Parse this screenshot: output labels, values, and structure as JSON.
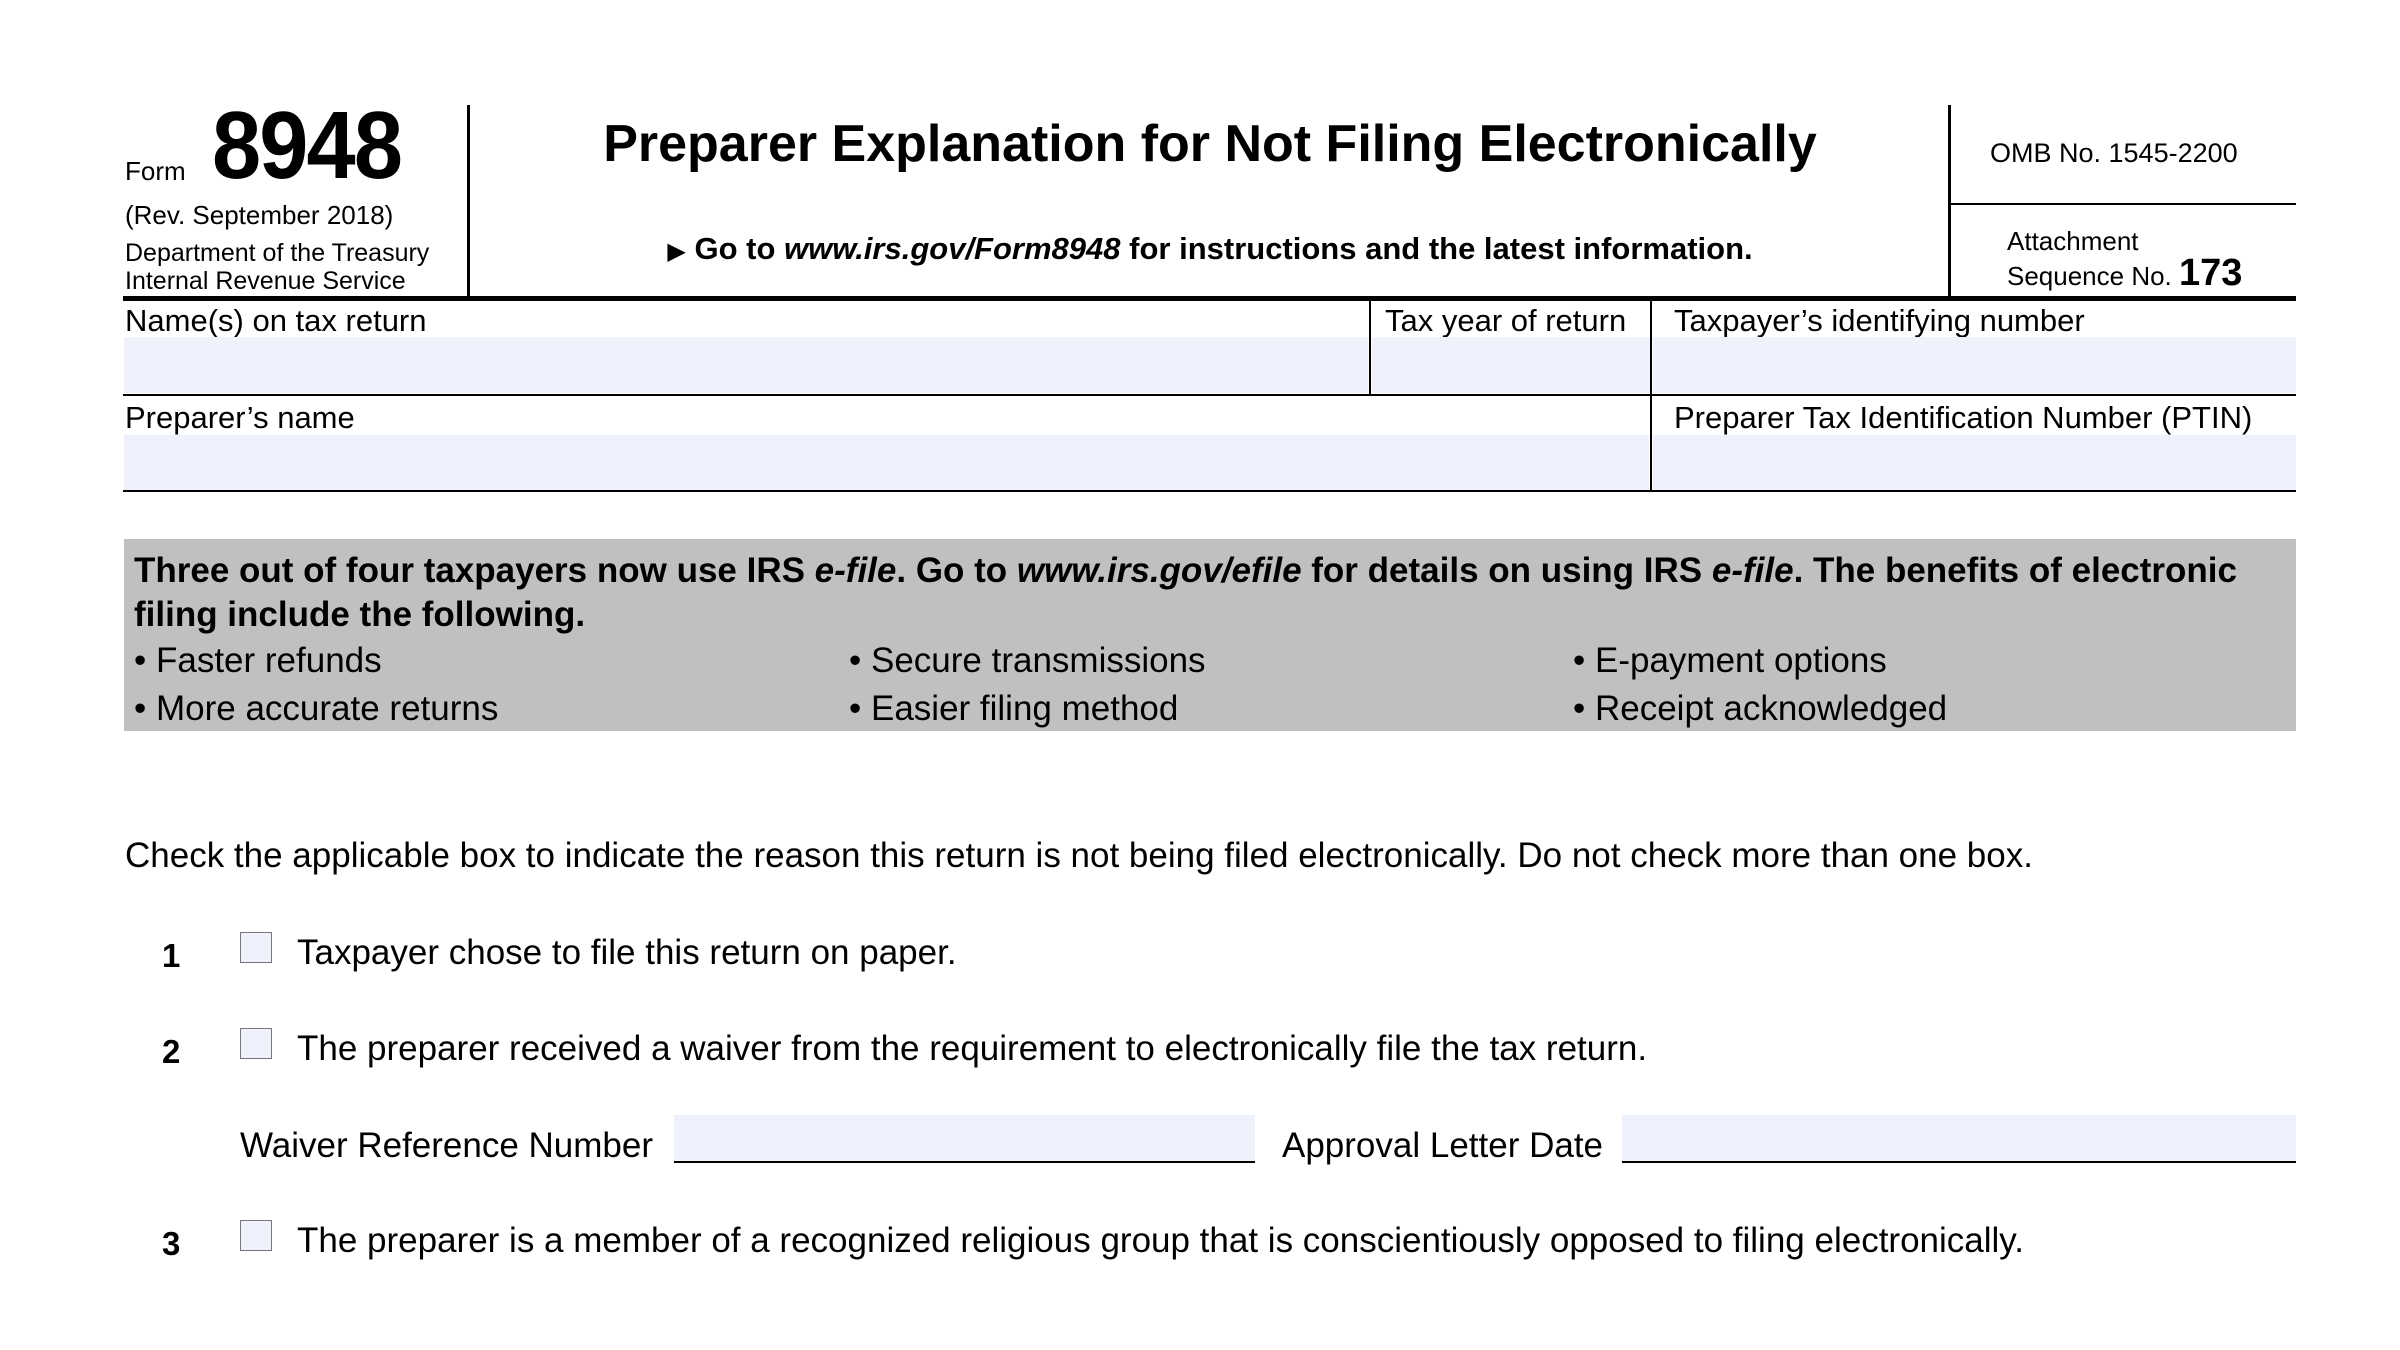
{
  "header": {
    "form_word": "Form",
    "form_number": "8948",
    "revision": "(Rev. September 2018)",
    "department": "Department of the Treasury",
    "agency": "Internal Revenue Service",
    "title": "Preparer Explanation for Not Filing Electronically",
    "goto_prefix": "Go to ",
    "goto_url": "www.irs.gov/Form8948",
    "goto_suffix": " for instructions and the latest information.",
    "arrow_icon": "▶",
    "omb": "OMB No. 1545-2200",
    "attachment_label": "Attachment",
    "sequence_label": "Sequence No.",
    "sequence_number": "173"
  },
  "fields": {
    "names_label": "Name(s) on tax return",
    "names_value": "",
    "tax_year_label": "Tax year of return",
    "tax_year_value": "",
    "tin_label": "Taxpayer’s identifying number",
    "tin_value": "",
    "preparer_name_label": "Preparer’s name",
    "preparer_name_value": "",
    "ptin_label": "Preparer Tax Identification Number (PTIN)",
    "ptin_value": ""
  },
  "efile_box": {
    "t1": "Three out of four taxpayers now use IRS ",
    "t2": "e-file",
    "t3": ". Go to ",
    "t4": "www.irs.gov/efile",
    "t5": " for details on using IRS ",
    "t6": "e-file",
    "t7": ". The benefits of electronic filing include the following.",
    "benefits": [
      "• Faster refunds",
      "• Secure transmissions",
      "• E-payment options",
      "• More accurate returns",
      "• Easier filing method",
      "• Receipt acknowledged"
    ]
  },
  "instructions": "Check the applicable box to indicate the reason this return is not being filed electronically. Do not check more than one box.",
  "lines": [
    {
      "number": "1",
      "text": "Taxpayer chose to file this return on paper.",
      "checked": false
    },
    {
      "number": "2",
      "text": "The preparer received a waiver from the requirement to electronically file the tax return.",
      "checked": false
    },
    {
      "number": "3",
      "text": "The preparer is a member of a recognized religious group that is conscientiously opposed to filing electronically.",
      "checked": false
    }
  ],
  "waiver": {
    "reference_label": "Waiver Reference Number",
    "reference_value": "",
    "approval_label": "Approval Letter Date",
    "approval_value": ""
  }
}
